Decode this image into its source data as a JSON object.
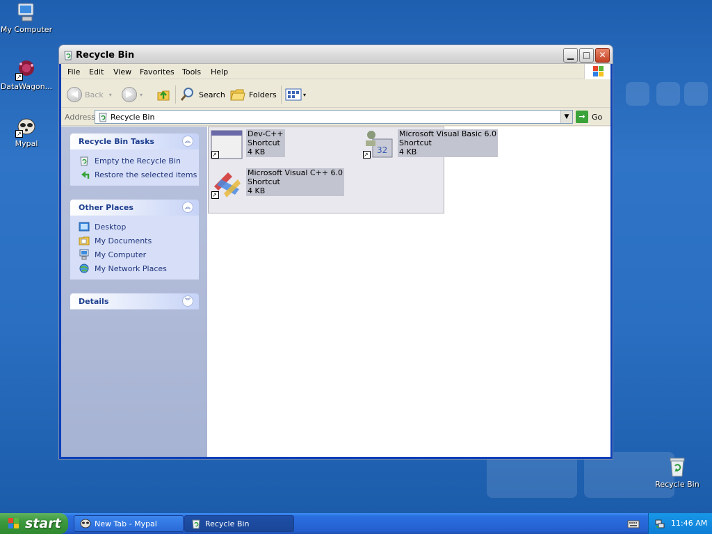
{
  "desktop": {
    "icons": [
      {
        "label": "My Computer"
      },
      {
        "label": "DataWagon..."
      },
      {
        "label": "Mypal"
      },
      {
        "label": "Recycle Bin"
      }
    ]
  },
  "window": {
    "title": "Recycle Bin",
    "menu": [
      "File",
      "Edit",
      "View",
      "Favorites",
      "Tools",
      "Help"
    ],
    "toolbar": {
      "back_label": "Back",
      "search_label": "Search",
      "folders_label": "Folders"
    },
    "address": {
      "label": "Address",
      "value": "Recycle Bin",
      "go_label": "Go"
    },
    "tasks_panel": {
      "title": "Recycle Bin Tasks",
      "items": [
        "Empty the Recycle Bin",
        "Restore the selected items"
      ]
    },
    "places_panel": {
      "title": "Other Places",
      "items": [
        "Desktop",
        "My Documents",
        "My Computer",
        "My Network Places"
      ]
    },
    "details_panel": {
      "title": "Details"
    },
    "files": [
      {
        "name": "Dev-C++",
        "type": "Shortcut",
        "size": "4 KB"
      },
      {
        "name": "Microsoft Visual Basic 6.0",
        "type": "Shortcut",
        "size": "4 KB"
      },
      {
        "name": "Microsoft Visual C++ 6.0",
        "type": "Shortcut",
        "size": "4 KB"
      }
    ]
  },
  "taskbar": {
    "start_label": "start",
    "tasks": [
      {
        "label": "New Tab - Mypal"
      },
      {
        "label": "Recycle Bin"
      }
    ],
    "clock": "11:46 AM"
  },
  "colors": {
    "desktop": "#2a6fc2",
    "taskbar": "#245fcf",
    "start_button": "#3d993d",
    "panel_title": "#1e3f8f"
  }
}
